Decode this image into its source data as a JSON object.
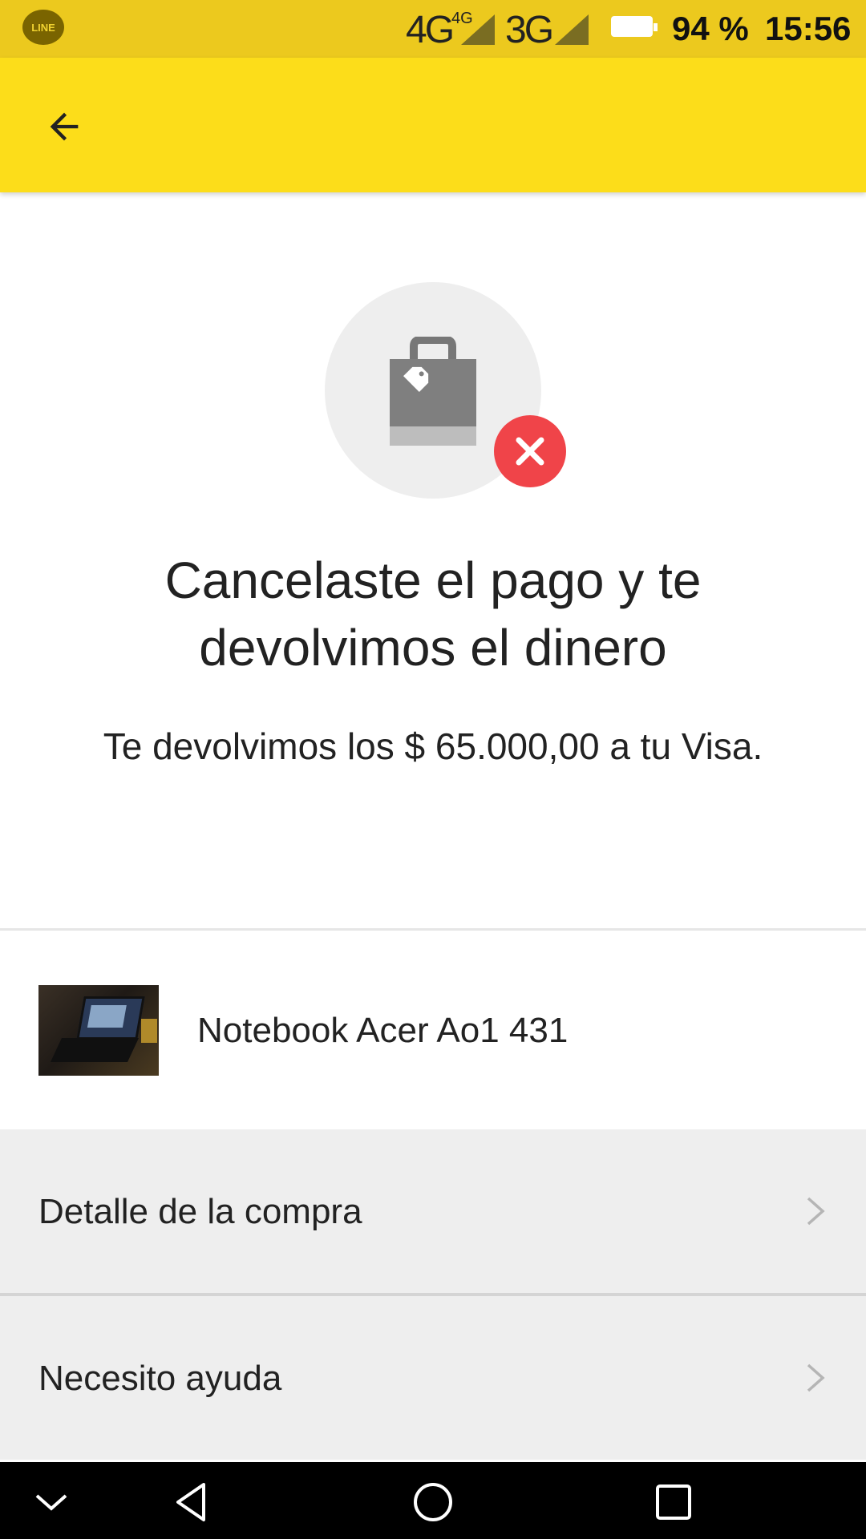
{
  "status_bar": {
    "network_primary": "4G",
    "network_primary_sup": "4G",
    "network_secondary": "3G",
    "battery_percent": "94 %",
    "time": "15:56",
    "app_notification_icon": "line-icon",
    "app_notification_text": "LINE",
    "colors": {
      "background": "#ecc91e"
    }
  },
  "app_bar": {
    "back_icon": "arrow-back-icon",
    "colors": {
      "background": "#fcdd1a"
    }
  },
  "hero": {
    "icon": "shopping-bag-icon",
    "badge_icon": "close-icon",
    "colors": {
      "circle": "#eeeeee",
      "badge": "#f04449"
    }
  },
  "message": {
    "title": "Cancelaste el pago y te devolvimos el dinero",
    "subtitle": "Te devolvimos los $ 65.000,00 a tu Visa."
  },
  "item": {
    "name": "Notebook Acer Ao1 431",
    "thumbnail": "laptop-photo"
  },
  "actions": [
    {
      "label": "Detalle de la compra",
      "icon": "chevron-right-icon"
    },
    {
      "label": "Necesito ayuda",
      "icon": "chevron-right-icon"
    }
  ],
  "nav_bar": {
    "buttons": [
      "hide-keyboard-icon",
      "back-triangle-icon",
      "home-circle-icon",
      "recents-square-icon"
    ]
  }
}
